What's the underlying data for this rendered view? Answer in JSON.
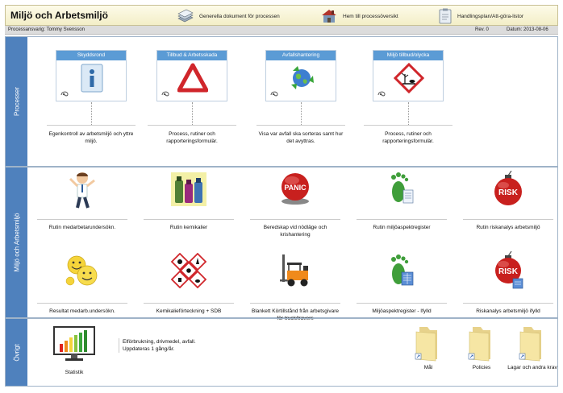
{
  "header": {
    "title": "Miljö och Arbetsmiljö",
    "links": [
      {
        "label": "Generella dokument för processen",
        "icon": "documents-stack-icon"
      },
      {
        "label": "Hem till processöversikt",
        "icon": "house-icon"
      },
      {
        "label": "Handlingsplan/Att-göra-listor",
        "icon": "clipboard-icon"
      }
    ]
  },
  "subbar": {
    "owner": "Processansvarig: Tommy Svensson",
    "revision": "Rev. 0",
    "date": "Datum: 2013-08-06"
  },
  "sections": {
    "processer": "Processer",
    "miljo": "Miljö och Arbetsmiljö",
    "ovrigt": "Övrigt"
  },
  "processes": [
    {
      "title": "Skyddsrond",
      "icon": "info-sign-icon",
      "text": "Egenkontroll av arbetsmiljö och yttre miljö."
    },
    {
      "title": "Tillbud & Arbetsskada",
      "icon": "warning-triangle-icon",
      "text": "Process, rutiner och rapporteringsformulär."
    },
    {
      "title": "Avfallshantering",
      "icon": "recycle-globe-icon",
      "text": "Visa var avfall ska sorteras samt hur det avyttras."
    },
    {
      "title": "Miljö tillbud/olycka",
      "icon": "environment-hazard-icon",
      "text": "Process, rutiner och rapporteringsformulär."
    }
  ],
  "routines_row1": [
    {
      "label": "Rutin medarbetarundersökn.",
      "icon": "happy-worker-icon"
    },
    {
      "label": "Rutin kemikalier",
      "icon": "chemical-bottles-icon"
    },
    {
      "label": "Beredskap vid nödläge och krishantering",
      "icon": "panic-button-icon",
      "badge": "PANIC"
    },
    {
      "label": "Rutin miljöaspektregister",
      "icon": "green-footprint-icon"
    },
    {
      "label": "Rutin riskanalys arbetsmiljö",
      "icon": "risk-bomb-icon",
      "badge": "RISK"
    }
  ],
  "routines_row2": [
    {
      "label": "Resultat medarb.undersökn.",
      "icon": "smiley-faces-icon"
    },
    {
      "label": "Kemikalieförteckning + SDB",
      "icon": "hazard-symbols-icon"
    },
    {
      "label": "Blankett Körtillstånd från arbetsgivare för truck/travers",
      "icon": "forklift-icon"
    },
    {
      "label": "Miljöaspektregister - Ifylld",
      "icon": "green-footprint-sheet-icon"
    },
    {
      "label": "Riskanalys arbetsmiljö ifylld",
      "icon": "risk-bomb-sheet-icon",
      "badge": "RISK"
    }
  ],
  "ovrigt": {
    "stat_label": "Statistik",
    "stat_text_1": "Elförbrukning, drivmedel, avfall.",
    "stat_text_2": "Uppdateras 1 gång/år.",
    "folders": [
      "Mål",
      "Policies",
      "Lagar och andra krav"
    ]
  }
}
